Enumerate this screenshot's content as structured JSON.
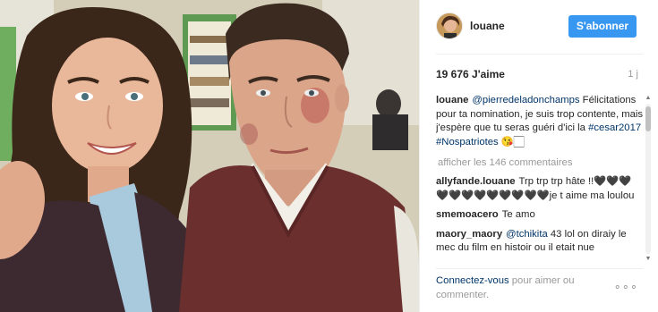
{
  "post": {
    "photo_alt": "",
    "header": {
      "username": "louane",
      "follow_label": "S'abonner"
    },
    "likes_label": "19 676 J'aime",
    "age_label": "1 j",
    "caption": {
      "author": "louane",
      "mention": "@pierredeladonchamps",
      "text": "Félicitations pour ta nomination, je suis trop contente, mais j'espère que tu seras guéri d'ici la",
      "tag1": "#cesar2017",
      "tag2": "#Nospatriotes",
      "emoji": "😘🏻"
    },
    "show_more_label": "afficher les 146 commentaires",
    "comments": [
      {
        "author": "allyfande.louane",
        "text": "Trp trp trp hâte !!🖤🖤🖤🖤🖤🖤🖤🖤🖤🖤🖤🖤je t aime ma loulou"
      },
      {
        "author": "smemoacero",
        "text": "Te amo"
      },
      {
        "author": "maory_maory",
        "mention": "@tchikita",
        "text": "43 lol on diraiy le mec du film en histoir ou il etait nue"
      }
    ],
    "footer": {
      "login_link": "Connectez-vous",
      "login_rest": " pour aimer ou commenter."
    },
    "more_options_label": "∘∘∘"
  }
}
